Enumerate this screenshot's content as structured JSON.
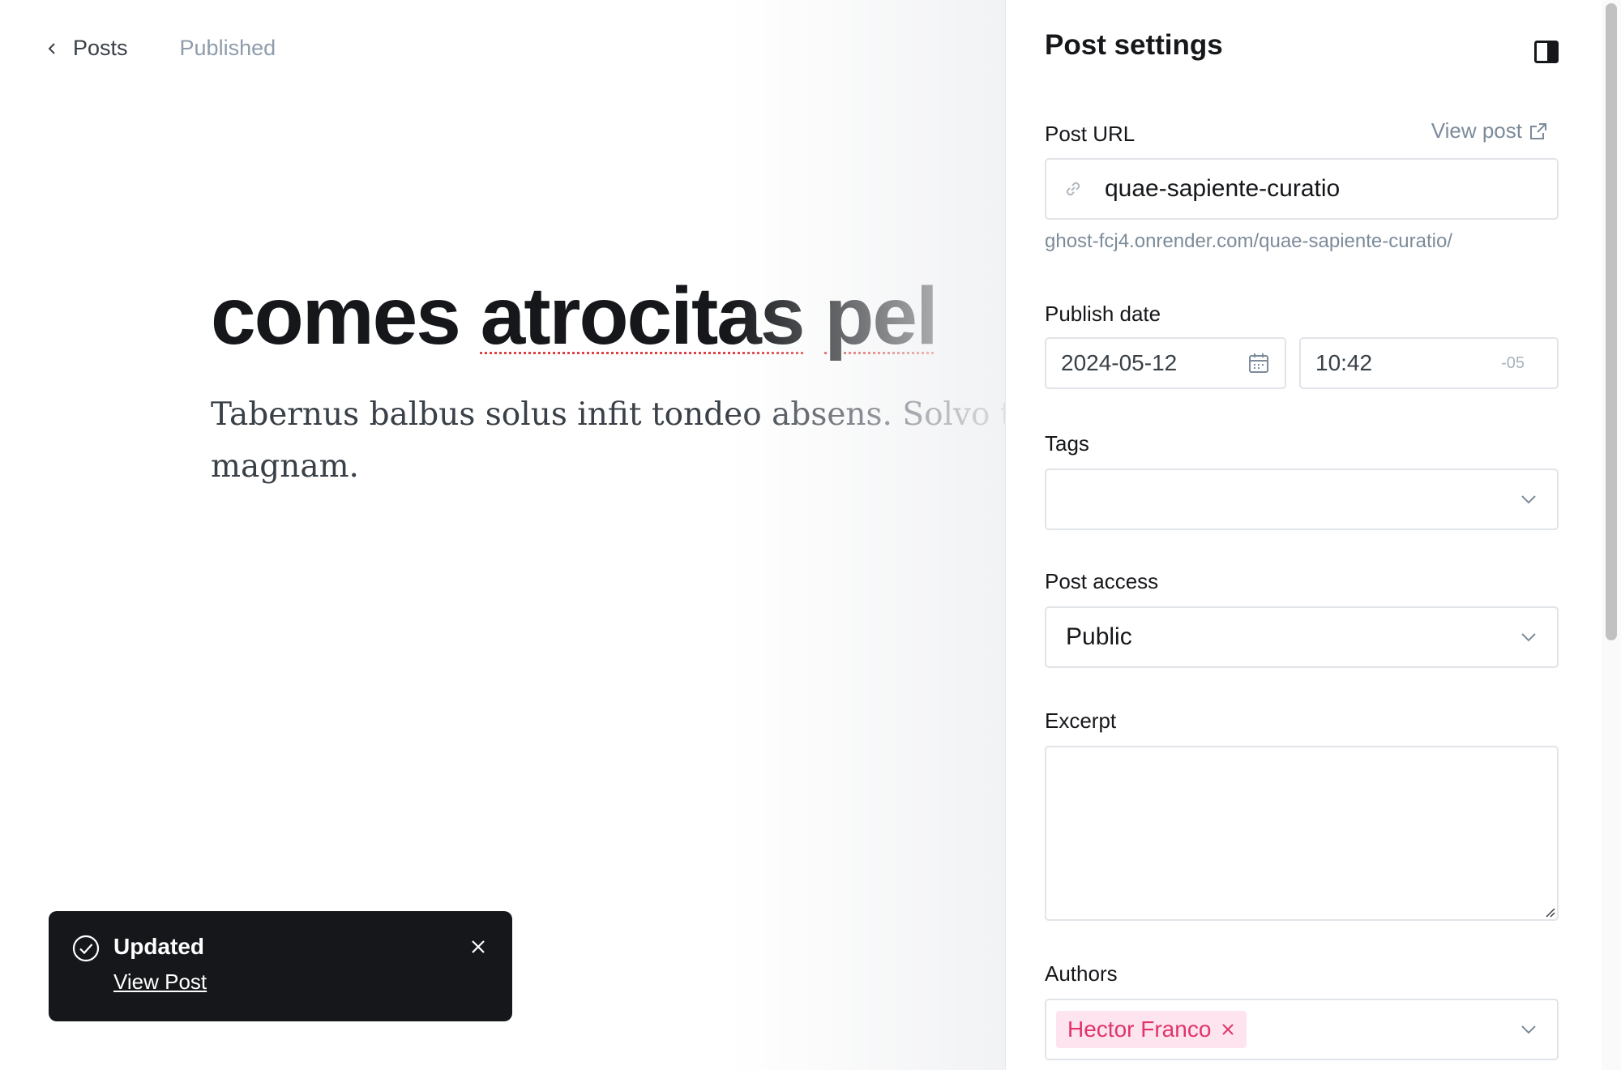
{
  "topbar": {
    "back_label": "Posts",
    "status": "Published"
  },
  "post": {
    "title_part1": "comes ",
    "title_part2": "atrocitas",
    "title_part3": " ",
    "title_part4": "pel",
    "body": "Tabernus balbus solus infit tondeo absens. Solvo trepide suppono magnam."
  },
  "toast": {
    "title": "Updated",
    "link": "View Post"
  },
  "settings": {
    "title": "Post settings",
    "post_url_label": "Post URL",
    "view_post_label": "View post",
    "slug": "quae-sapiente-curatio",
    "url_hint": "ghost-fcj4.onrender.com/quae-sapiente-curatio/",
    "publish_date_label": "Publish date",
    "date": "2024-05-12",
    "time": "10:42",
    "timezone": "-05",
    "tags_label": "Tags",
    "tags_value": "",
    "access_label": "Post access",
    "access_value": "Public",
    "excerpt_label": "Excerpt",
    "authors_label": "Authors",
    "author_name": "Hector Franco"
  },
  "colors": {
    "accent_pink": "#e0346a",
    "toast_bg": "#15171a",
    "muted": "#7c8b9a"
  }
}
